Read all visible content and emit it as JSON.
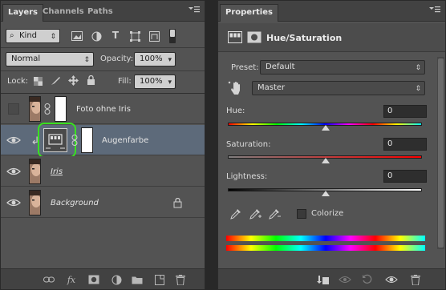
{
  "layers_panel": {
    "tabs": [
      "Layers",
      "Channels",
      "Paths"
    ],
    "filter": {
      "label": "Kind"
    },
    "blend_mode": "Normal",
    "opacity_label": "Opacity:",
    "opacity_value": "100%",
    "lock_label": "Lock:",
    "fill_label": "Fill:",
    "fill_value": "100%",
    "layers": [
      {
        "name": "Foto ohne Iris",
        "visible": false,
        "has_mask": true,
        "italic": false,
        "underline": false
      },
      {
        "name": "Augenfarbe",
        "visible": true,
        "adjustment": true,
        "selected": true,
        "italic": false
      },
      {
        "name": "Iris",
        "visible": true,
        "italic": true,
        "underline": true
      },
      {
        "name": "Background",
        "visible": true,
        "italic": true,
        "locked": true
      }
    ],
    "bottom_icons": [
      "link-icon",
      "fx-icon",
      "mask-icon",
      "adjustment-icon",
      "folder-icon",
      "new-layer-icon",
      "trash-icon"
    ]
  },
  "properties_panel": {
    "tab": "Properties",
    "title": "Hue/Saturation",
    "preset_label": "Preset:",
    "preset_value": "Default",
    "channel_value": "Master",
    "hue_label": "Hue:",
    "hue_value": "0",
    "saturation_label": "Saturation:",
    "saturation_value": "0",
    "lightness_label": "Lightness:",
    "lightness_value": "0",
    "colorize_label": "Colorize",
    "colorize_checked": false
  },
  "colors": {
    "panel_bg": "#535353",
    "header_bg": "#424242",
    "selected_layer": "#5d6a7a",
    "highlight_green": "#39e020"
  }
}
